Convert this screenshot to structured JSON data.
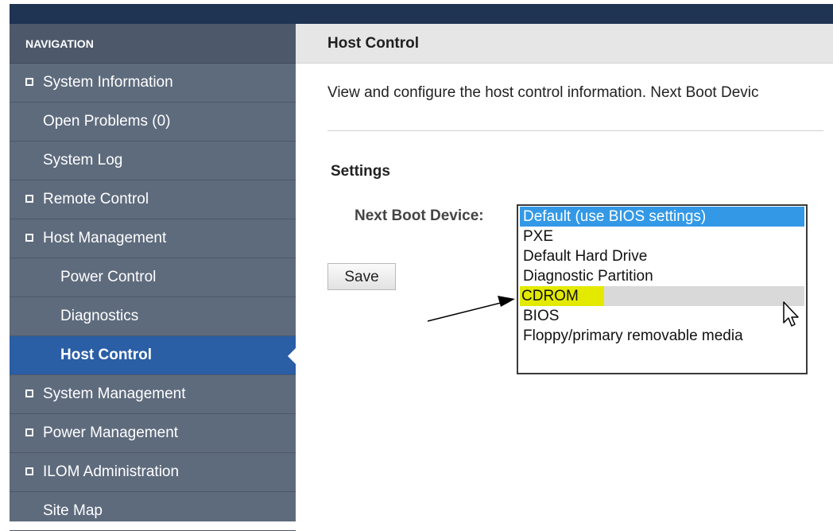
{
  "navigation": {
    "header": "NAVIGATION",
    "items": [
      {
        "label": "System Information",
        "level": 0,
        "expander": true,
        "active": false
      },
      {
        "label": "Open Problems (0)",
        "level": 0,
        "expander": false,
        "active": false
      },
      {
        "label": "System Log",
        "level": 0,
        "expander": false,
        "active": false
      },
      {
        "label": "Remote Control",
        "level": 0,
        "expander": true,
        "active": false
      },
      {
        "label": "Host Management",
        "level": 0,
        "expander": true,
        "active": false
      },
      {
        "label": "Power Control",
        "level": 1,
        "expander": false,
        "active": false
      },
      {
        "label": "Diagnostics",
        "level": 1,
        "expander": false,
        "active": false
      },
      {
        "label": "Host Control",
        "level": 1,
        "expander": false,
        "active": true
      },
      {
        "label": "System Management",
        "level": 0,
        "expander": true,
        "active": false
      },
      {
        "label": "Power Management",
        "level": 0,
        "expander": true,
        "active": false
      },
      {
        "label": "ILOM Administration",
        "level": 0,
        "expander": true,
        "active": false
      },
      {
        "label": "Site Map",
        "level": 0,
        "expander": false,
        "active": false
      }
    ]
  },
  "main": {
    "title": "Host Control",
    "description": "View and configure the host control information. Next Boot Devic",
    "settings_title": "Settings",
    "next_boot_label": "Next Boot Device:",
    "save_label": "Save",
    "boot_options": [
      "Default (use BIOS settings)",
      "PXE",
      "Default Hard Drive",
      "Diagnostic Partition",
      "CDROM",
      "BIOS",
      "Floppy/primary removable media"
    ],
    "selected_option": "Default (use BIOS settings)",
    "highlighted_option": "CDROM"
  },
  "colors": {
    "topbar": "#1f3352",
    "sidebar": "#5e6b7d",
    "active_nav": "#2a5ea5",
    "selected_option": "#3399e6",
    "annotation_highlight": "#e3ea00"
  },
  "icons": {
    "expander": "square-expander-icon",
    "annotation": "arrow-annotation",
    "cursor": "mouse-pointer-icon"
  }
}
